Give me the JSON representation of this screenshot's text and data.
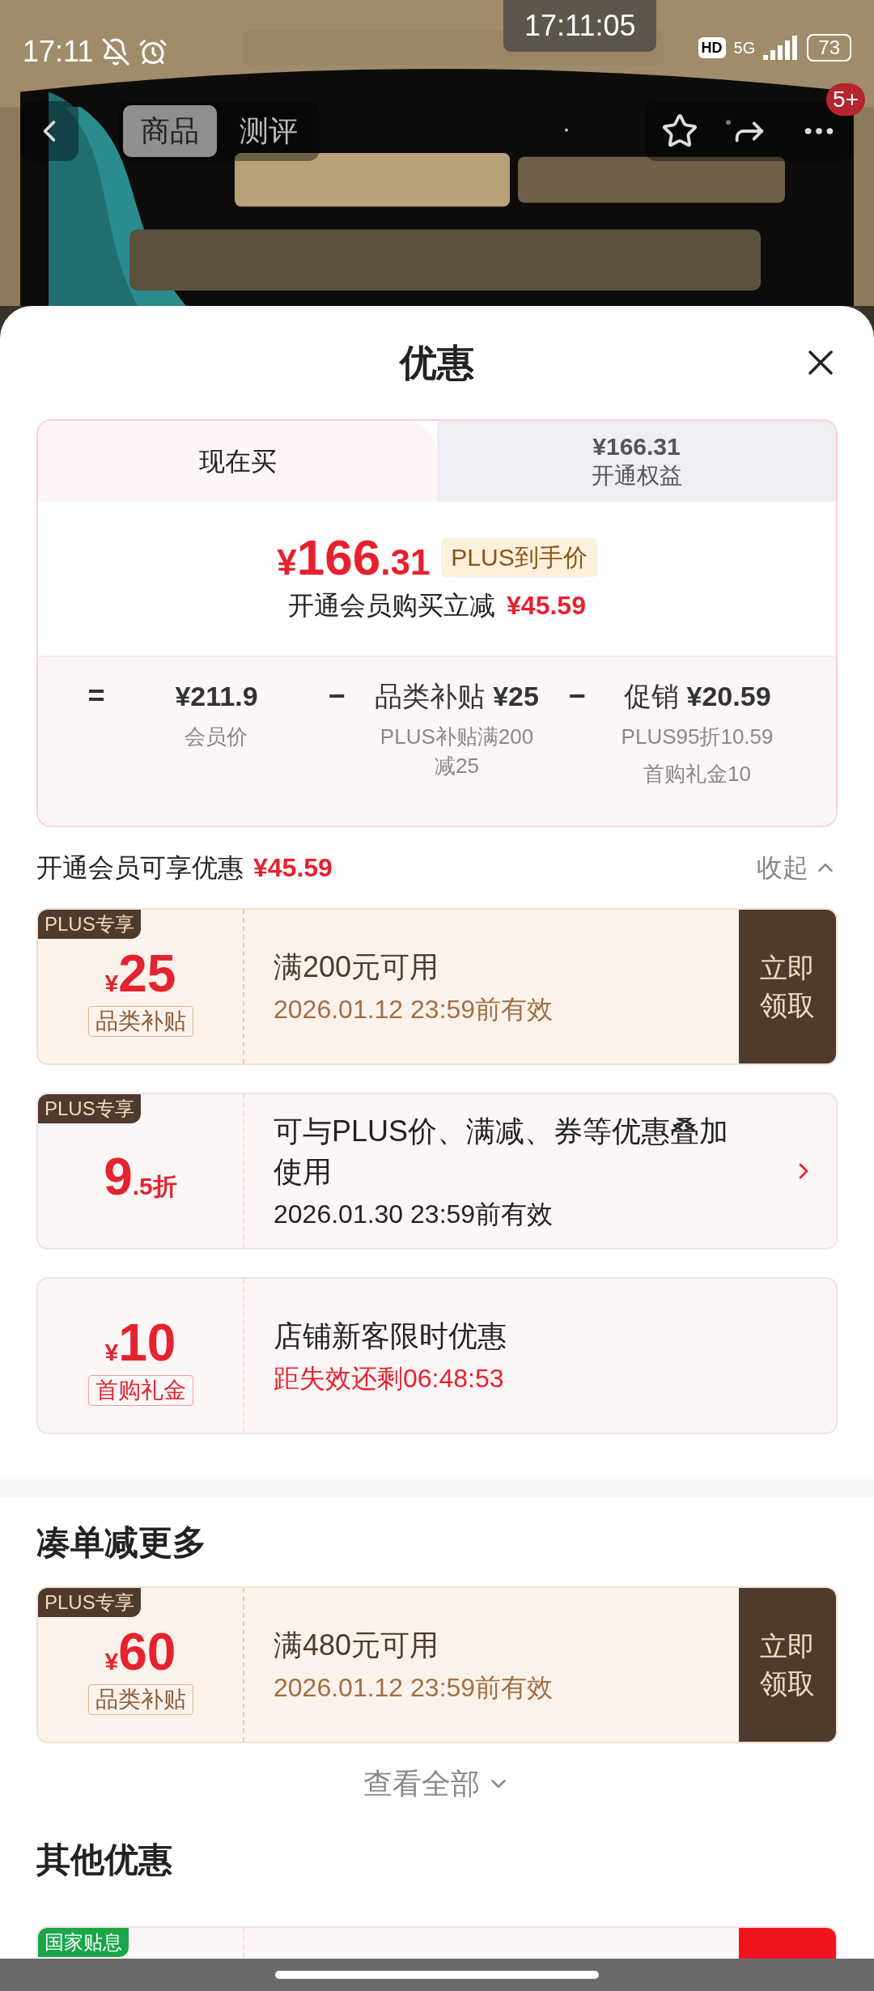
{
  "status_bar": {
    "time": "17:11",
    "hd": "HD",
    "network": "5G",
    "battery": "73"
  },
  "recording_clock": "17:11:05",
  "product_header": {
    "tabs": [
      {
        "label": "商品",
        "selected": true
      },
      {
        "label": "测评",
        "selected": false
      }
    ],
    "badge": "5+"
  },
  "sheet": {
    "title": "优惠"
  },
  "price_card": {
    "tabs": [
      {
        "label": "现在买",
        "selected": true
      },
      {
        "price": "¥166.31",
        "label": "开通权益",
        "selected": false
      }
    ],
    "final_price": {
      "currency": "¥",
      "integer": "166",
      "decimal": ".31"
    },
    "price_tag": "PLUS到手价",
    "saving_label": "开通会员购买立减",
    "saving_amount": "¥45.59",
    "breakdown": [
      {
        "operator": "=",
        "value": "¥211.9",
        "notes": [
          "会员价"
        ]
      },
      {
        "operator": "−",
        "label": "品类补贴",
        "value": "¥25",
        "notes": [
          "PLUS补贴满200减25"
        ]
      },
      {
        "operator": "−",
        "label": "促销",
        "value": "¥20.59",
        "notes": [
          "PLUS95折10.59",
          "首购礼金10"
        ]
      }
    ]
  },
  "member_offers": {
    "title": "开通会员可享优惠",
    "amount": "¥45.59",
    "toggle": "收起",
    "coupons": [
      {
        "kind": "claim",
        "tag": {
          "text": "PLUS专享",
          "color": "#4e3b2e"
        },
        "currency": "¥",
        "amount": "25",
        "category": "品类补贴",
        "title": "满200元可用",
        "subtitle": "2026.01.12 23:59前有效",
        "action": "立即领取"
      },
      {
        "kind": "detail",
        "tag": {
          "text": "PLUS专享",
          "color": "#4e3b2e"
        },
        "amount": "9",
        "amount_suffix": ".5折",
        "title": "可与PLUS价、满减、券等优惠叠加使用",
        "subtitle": "2026.01.30 23:59前有效"
      },
      {
        "kind": "info",
        "currency": "¥",
        "amount": "10",
        "category": "首购礼金",
        "title": "店铺新客限时优惠",
        "subtitle": "距失效还剩06:48:53"
      }
    ]
  },
  "bundle_offers": {
    "title": "凑单减更多",
    "coupons": [
      {
        "kind": "claim",
        "tag": {
          "text": "PLUS专享",
          "color": "#4e3b2e"
        },
        "currency": "¥",
        "amount": "60",
        "category": "品类补贴",
        "title": "满480元可用",
        "subtitle": "2026.01.12 23:59前有效",
        "action": "立即领取"
      }
    ],
    "more": "查看全部"
  },
  "other_offers": {
    "title": "其他优惠",
    "coupons": [
      {
        "kind": "partial",
        "tag": {
          "text": "国家贴息",
          "color": "#1aa64a"
        }
      }
    ]
  }
}
